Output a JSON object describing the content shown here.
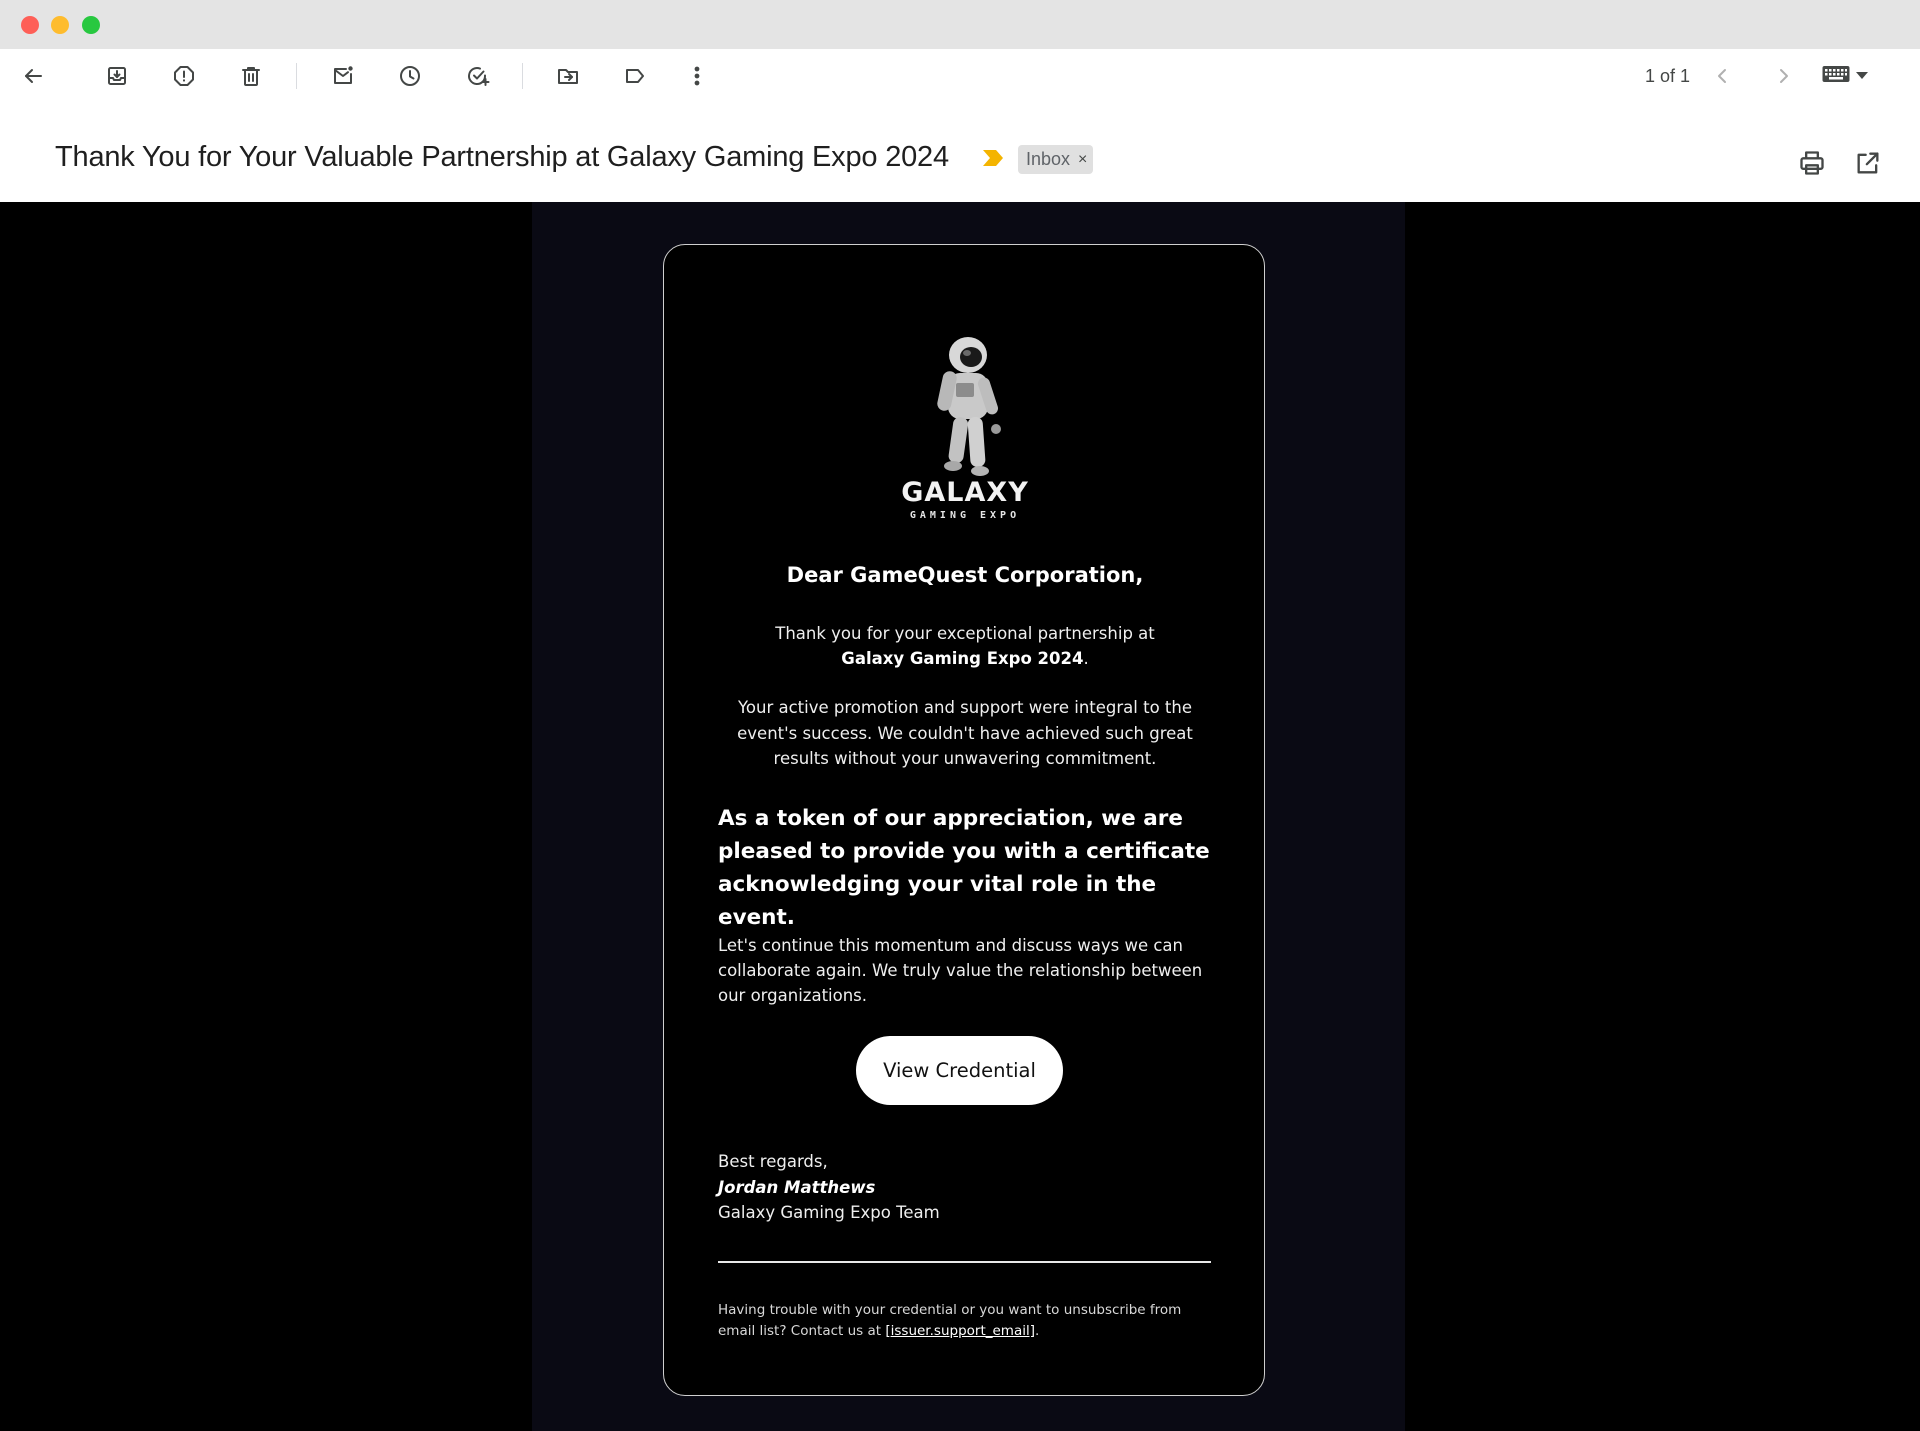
{
  "toolbar": {
    "icons": [
      "back-arrow-icon",
      "archive-icon",
      "report-spam-icon",
      "delete-icon",
      "mark-unread-icon",
      "snooze-icon",
      "add-task-icon",
      "move-to-icon",
      "label-icon",
      "more-vert-icon"
    ],
    "pager": "1 of 1"
  },
  "subject_row": {
    "subject": "Thank You for Your Valuable Partnership at Galaxy Gaming Expo 2024",
    "label": "Inbox",
    "label_remove": "×",
    "importance_color": "#f4b400"
  },
  "email": {
    "logo_title": "GALAXY",
    "logo_subtitle": "GAMING EXPO",
    "greeting": "Dear GameQuest Corporation,",
    "p1_text": "Thank you for your exceptional partnership at",
    "p1_event": "Galaxy Gaming Expo 2024",
    "p1_end": ".",
    "p2": "Your active promotion and support were integral to the event's success. We couldn't have achieved such great results without your unwavering commitment.",
    "highlight": "As a token of our appreciation, we are pleased to provide you with a certificate acknowledging your vital role in the event.",
    "p3": "Let's continue this momentum and discuss ways we can collaborate again. We truly value the relationship between our organizations.",
    "cta": "View Credential",
    "signoff": "Best regards,",
    "sender_name": "Jordan Matthews",
    "sender_team": "Galaxy Gaming Expo Team",
    "footer_text": "Having trouble with your credential or you want to unsubscribe from email list? Contact us at ",
    "footer_link": "[issuer.support_email]",
    "footer_end": "."
  },
  "colors": {
    "card_bg": "#000000",
    "page_bg": "#000000",
    "column_bg": "#0a0a14",
    "button_bg": "#ffffff"
  }
}
